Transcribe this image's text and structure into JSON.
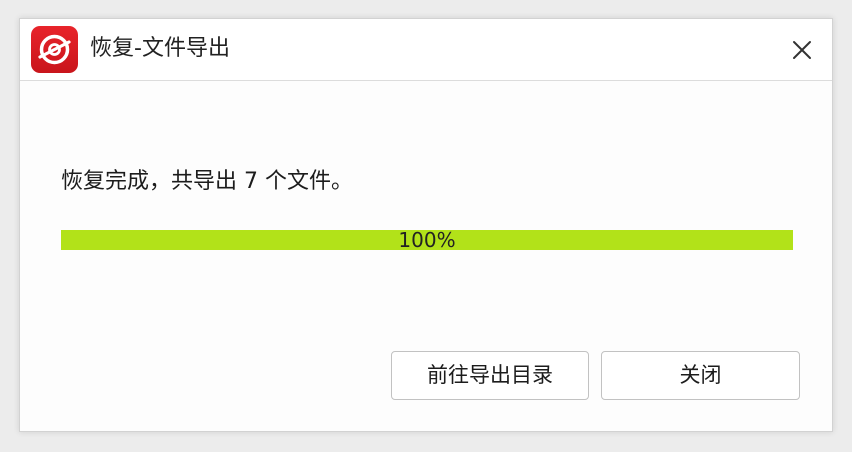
{
  "window": {
    "title": "恢复-文件导出",
    "app_icon": "recovery-app-icon",
    "close_icon": "close-icon"
  },
  "status": {
    "message": "恢复完成，共导出 7 个文件。"
  },
  "progress": {
    "percent": 100,
    "label": "100%",
    "fill_color": "#b2e219"
  },
  "buttons": {
    "open_folder": "前往导出目录",
    "close": "关闭"
  },
  "colors": {
    "brand": "#d71920",
    "progress": "#b2e219"
  }
}
